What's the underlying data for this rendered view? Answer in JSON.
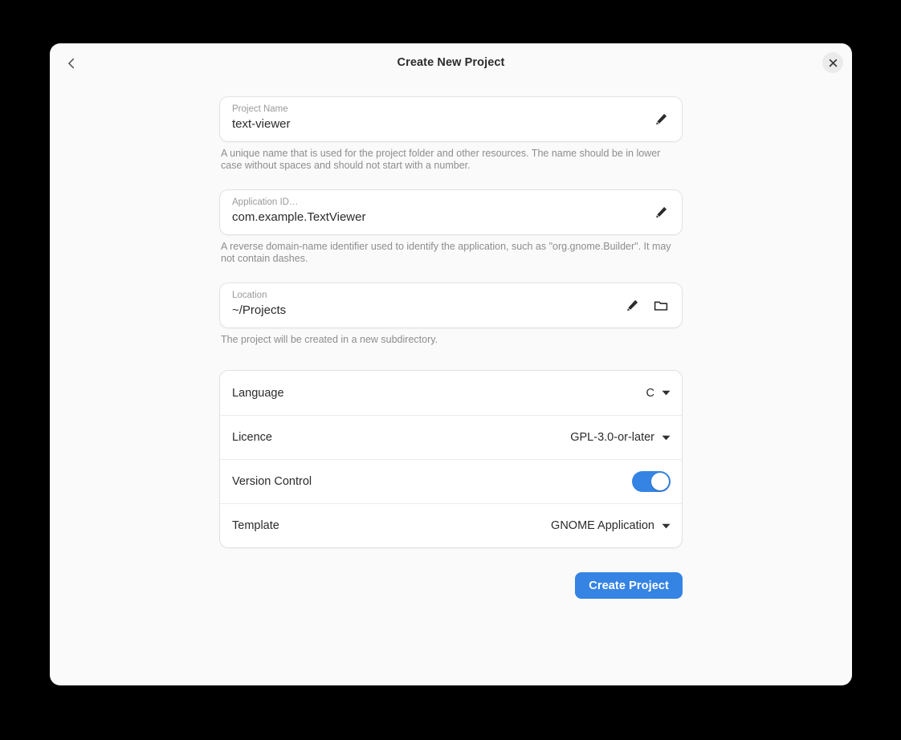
{
  "header": {
    "title": "Create New Project",
    "back_icon": "chevron-left-icon",
    "close_icon": "close-icon"
  },
  "fields": [
    {
      "name": "project-name",
      "label": "Project Name",
      "value": "text-viewer",
      "helper": "A unique name that is used for the project folder and other resources. The name should be in lower case without spaces and should not start with a number.",
      "actions": [
        "edit-icon"
      ]
    },
    {
      "name": "application-id",
      "label": "Application ID…",
      "value": "com.example.TextViewer",
      "helper": "A reverse domain-name identifier used to identify the application, such as \"org.gnome.Builder\". It may not contain dashes.",
      "actions": [
        "edit-icon"
      ]
    },
    {
      "name": "location",
      "label": "Location",
      "value": "~/Projects",
      "helper": "The project will be created in a new subdirectory.",
      "actions": [
        "edit-icon",
        "folder-icon"
      ]
    }
  ],
  "options": [
    {
      "name": "language",
      "label": "Language",
      "value": "C",
      "control": "dropdown"
    },
    {
      "name": "licence",
      "label": "Licence",
      "value": "GPL-3.0-or-later",
      "control": "dropdown"
    },
    {
      "name": "version-control",
      "label": "Version Control",
      "value": "on",
      "control": "toggle"
    },
    {
      "name": "template",
      "label": "Template",
      "value": "GNOME Application",
      "control": "dropdown"
    }
  ],
  "footer": {
    "create_label": "Create Project"
  },
  "colors": {
    "accent": "#3584e4",
    "dialog_bg": "#fafafa",
    "card_bg": "#ffffff",
    "text": "#2b2b2b",
    "muted_text": "#8d8d8d",
    "backdrop": "#000000"
  }
}
